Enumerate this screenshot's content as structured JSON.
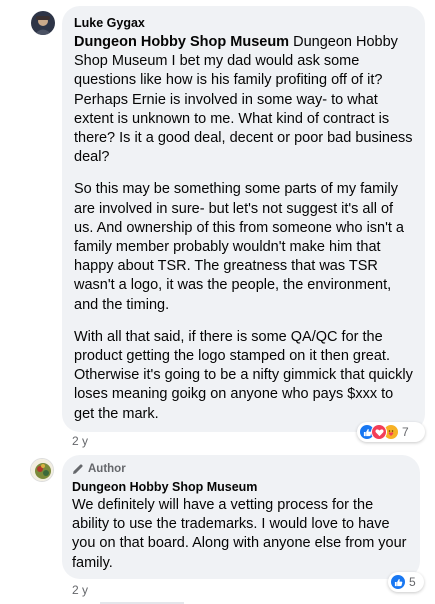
{
  "comments": [
    {
      "author": "Luke Gygax",
      "mention": "Dungeon Hobby Shop Museum",
      "paragraphs": [
        " Dungeon Hobby Shop Museum I bet my dad would ask some questions like how is his family profiting off of it? Perhaps Ernie is involved in some way- to what extent is unknown to me. What kind of contract is there? Is it a good deal, decent or poor bad business deal?",
        "So this may be something some parts of my family are involved in sure- but let's not suggest it's all of us. And ownership of this from someone who isn't a family member probably wouldn't make him that happy about TSR. The greatness that was TSR wasn't a logo, it was the people, the environment, and the timing.",
        "With all that said, if there is some QA/QC for the product getting the logo stamped on it then great. Otherwise it's going to be a nifty gimmick that quickly loses meaning goikg on anyone who pays $xxx to get the mark."
      ],
      "time": "2 y",
      "reaction_count": "7",
      "reactions": [
        "like-icon",
        "love-icon",
        "care-icon"
      ]
    },
    {
      "badge": "Author",
      "author": "Dungeon Hobby Shop Museum",
      "text": "We definitely will have a vetting process for the ability to use the trademarks. I would love to have you on that board. Along with anyone else from your family.",
      "time": "2 y",
      "reaction_count": "5",
      "reactions": [
        "like-icon"
      ]
    }
  ],
  "colors": {
    "bubble": "#f0f2f5",
    "like": "#1877f2",
    "love": "#f33e58",
    "care": "#f7b125",
    "meta": "#65676b"
  }
}
